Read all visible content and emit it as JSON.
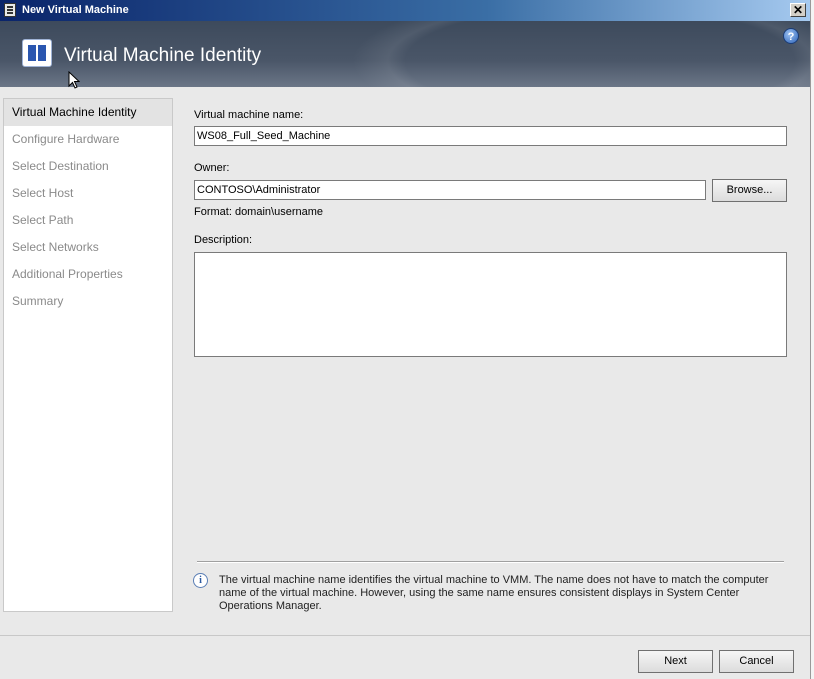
{
  "window": {
    "title": "New Virtual Machine",
    "close_label": "✕"
  },
  "header": {
    "title": "Virtual Machine Identity",
    "help_label": "?"
  },
  "nav": {
    "items": [
      {
        "label": "Virtual Machine Identity",
        "active": true
      },
      {
        "label": "Configure Hardware",
        "active": false
      },
      {
        "label": "Select Destination",
        "active": false
      },
      {
        "label": "Select Host",
        "active": false
      },
      {
        "label": "Select Path",
        "active": false
      },
      {
        "label": "Select Networks",
        "active": false
      },
      {
        "label": "Additional Properties",
        "active": false
      },
      {
        "label": "Summary",
        "active": false
      }
    ]
  },
  "form": {
    "vm_name_label": "Virtual machine name:",
    "vm_name_value": "WS08_Full_Seed_Machine",
    "owner_label": "Owner:",
    "owner_value": "CONTOSO\\Administrator",
    "browse_label": "Browse...",
    "format_hint": "Format: domain\\username",
    "description_label": "Description:",
    "description_value": ""
  },
  "info": {
    "icon": "info-icon",
    "text": "The virtual machine name identifies the virtual machine to VMM. The name does not have to match the computer name of the virtual machine. However, using the same name ensures consistent displays in System Center Operations Manager."
  },
  "footer": {
    "next_label": "Next",
    "cancel_label": "Cancel"
  }
}
